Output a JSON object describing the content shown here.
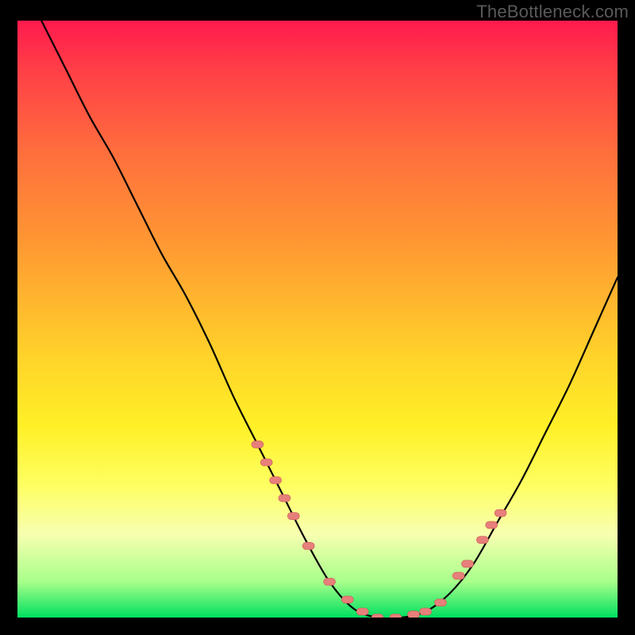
{
  "watermark": "TheBottleneck.com",
  "colors": {
    "frame": "#000000",
    "curve": "#000000",
    "marker_fill": "#e77f7a",
    "marker_stroke": "#c95b55"
  },
  "chart_data": {
    "type": "line",
    "title": "",
    "xlabel": "",
    "ylabel": "",
    "xlim": [
      0,
      100
    ],
    "ylim": [
      0,
      100
    ],
    "grid": false,
    "series": [
      {
        "name": "bottleneck_curve",
        "x": [
          0,
          4,
          8,
          12,
          16,
          20,
          24,
          28,
          32,
          36,
          40,
          44,
          48,
          52,
          56,
          60,
          64,
          68,
          72,
          76,
          80,
          84,
          88,
          92,
          96,
          100
        ],
        "y": [
          108,
          100,
          92,
          84,
          77,
          69,
          61,
          54,
          46,
          37,
          29,
          21,
          13,
          6,
          1.5,
          0,
          0,
          1,
          4,
          9,
          16,
          23,
          31,
          39,
          48,
          57
        ]
      }
    ],
    "markers": {
      "name": "highlighted_points",
      "x": [
        40.0,
        41.5,
        43.0,
        44.5,
        46.0,
        48.5,
        52.0,
        55.0,
        57.5,
        60.0,
        63.0,
        66.0,
        68.0,
        70.5,
        73.5,
        75.0,
        77.5,
        79.0,
        80.5
      ],
      "y": [
        29.0,
        26.0,
        23.0,
        20.0,
        17.0,
        12.0,
        6.0,
        3.0,
        1.0,
        0.0,
        0.0,
        0.5,
        1.0,
        2.5,
        7.0,
        9.0,
        13.0,
        15.5,
        17.5
      ]
    }
  }
}
